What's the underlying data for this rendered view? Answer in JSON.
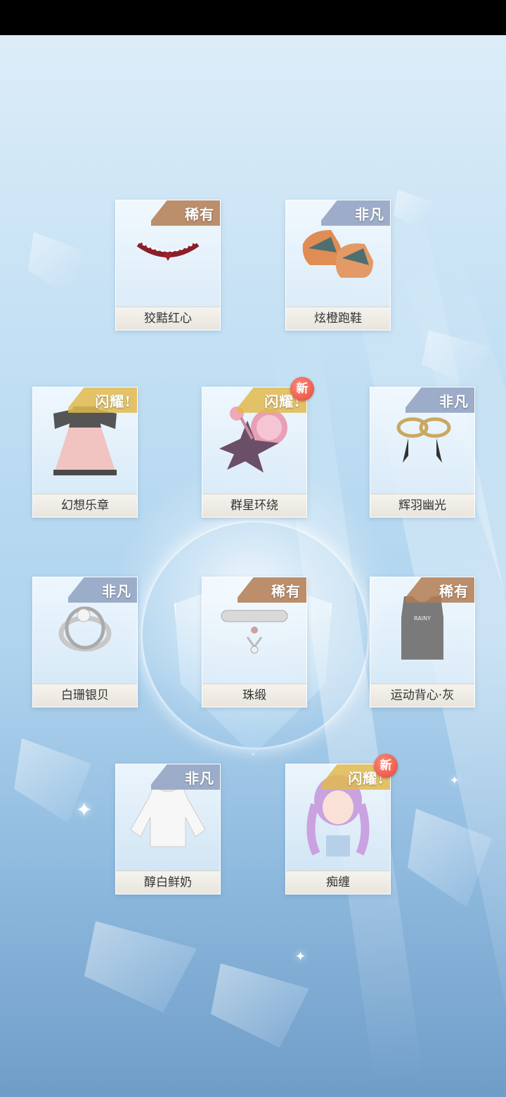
{
  "screen": {
    "title": ""
  },
  "rarity_colors": {
    "稀有": "#b27b52",
    "非凡": "#8ea0c0",
    "闪耀!": "#e0b84e"
  },
  "items": [
    {
      "name": "狡黠红心",
      "rarity": "稀有",
      "new": false,
      "icon": "choker-icon"
    },
    {
      "name": "炫橙跑鞋",
      "rarity": "非凡",
      "new": false,
      "icon": "sneakers-icon"
    },
    {
      "name": "幻想乐章",
      "rarity": "闪耀!",
      "new": false,
      "icon": "dress-icon"
    },
    {
      "name": "群星环绕",
      "rarity": "闪耀!",
      "new": true,
      "new_label": "新",
      "icon": "makeup-palette-icon"
    },
    {
      "name": "辉羽幽光",
      "rarity": "非凡",
      "new": false,
      "icon": "earrings-icon"
    },
    {
      "name": "白珊银贝",
      "rarity": "非凡",
      "new": false,
      "icon": "ring-icon"
    },
    {
      "name": "珠缎",
      "rarity": "稀有",
      "new": false,
      "icon": "collar-icon"
    },
    {
      "name": "运动背心·灰",
      "rarity": "稀有",
      "new": false,
      "icon": "tank-top-icon"
    },
    {
      "name": "醇白鲜奶",
      "rarity": "非凡",
      "new": false,
      "icon": "blouse-icon"
    },
    {
      "name": "痴缠",
      "rarity": "闪耀!",
      "new": true,
      "new_label": "新",
      "icon": "hairstyle-icon"
    }
  ]
}
